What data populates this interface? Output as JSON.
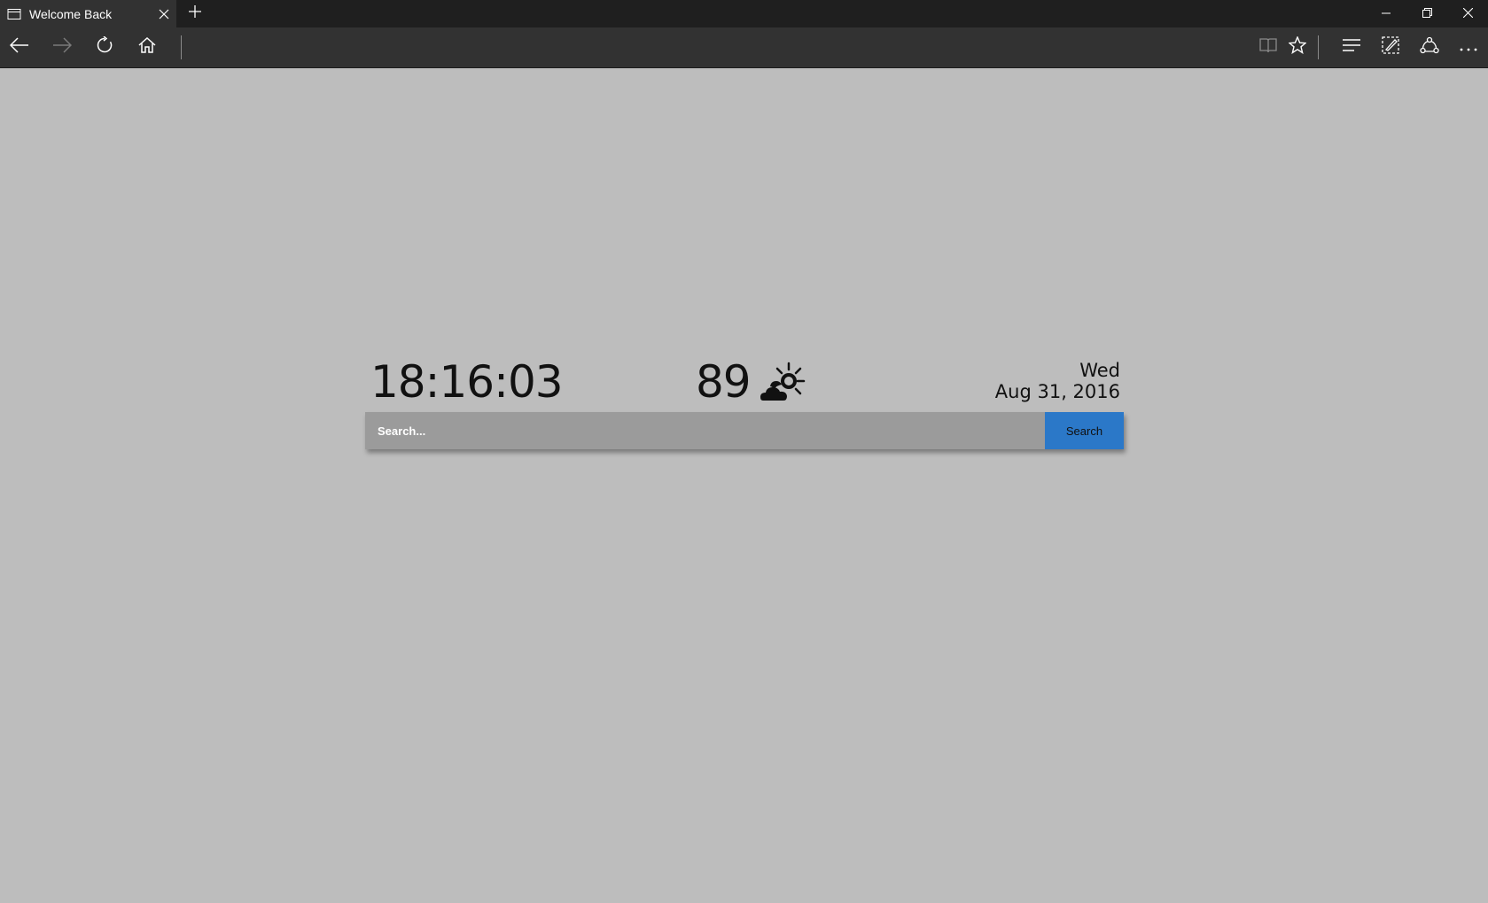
{
  "browser": {
    "tab": {
      "title": "Welcome Back",
      "icon": "page-icon"
    },
    "new_tab_icon": "plus-icon",
    "window_controls": [
      "minimize-icon",
      "restore-icon",
      "close-icon"
    ],
    "nav_icons": [
      "back-arrow-icon",
      "forward-arrow-icon",
      "refresh-icon",
      "home-icon"
    ],
    "right_icons": [
      "reading-view-icon",
      "favorite-star-icon",
      "hub-icon",
      "web-note-icon",
      "share-icon",
      "more-icon"
    ],
    "colors": {
      "titlebar": "#1f1f1f",
      "toolbar": "#323232"
    }
  },
  "page": {
    "background": "#bdbdbd",
    "clock": "18:16:03",
    "weather": {
      "temperature": "89",
      "icon": "partly-cloudy-icon"
    },
    "date": {
      "day": "Wed",
      "full": "Aug 31, 2016"
    },
    "search": {
      "placeholder": "Search...",
      "value": "",
      "button_label": "Search",
      "button_color": "#2b78c8"
    }
  }
}
